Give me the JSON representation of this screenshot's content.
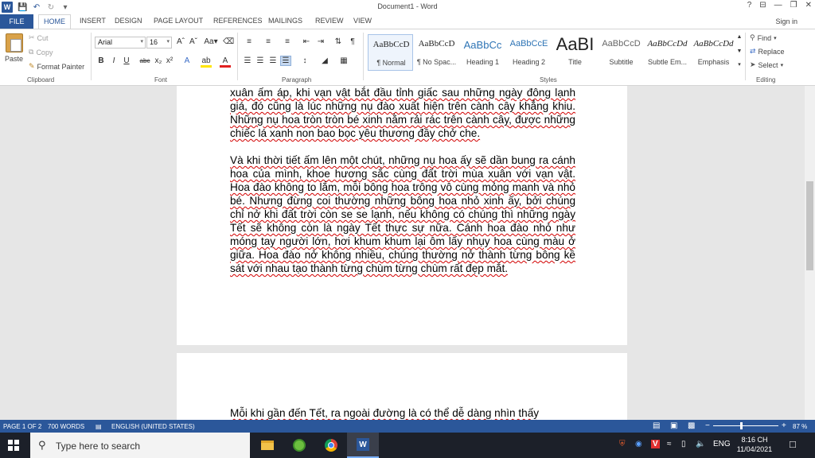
{
  "titlebar": {
    "doc_title": "Document1 - Word",
    "help": "?",
    "controls": [
      "⊟",
      "—",
      "❐",
      "✕"
    ]
  },
  "tabs": {
    "file": "FILE",
    "items": [
      "HOME",
      "INSERT",
      "DESIGN",
      "PAGE LAYOUT",
      "REFERENCES",
      "MAILINGS",
      "REVIEW",
      "VIEW"
    ],
    "signin": "Sign in"
  },
  "ribbon": {
    "clipboard": {
      "paste": "Paste",
      "cut": "Cut",
      "copy": "Copy",
      "format_painter": "Format Painter",
      "label": "Clipboard"
    },
    "font": {
      "name": "Arial",
      "size": "16",
      "label": "Font"
    },
    "paragraph": {
      "label": "Paragraph"
    },
    "styles": {
      "label": "Styles",
      "items": [
        {
          "sample": "AaBbCcD",
          "name": "¶ Normal"
        },
        {
          "sample": "AaBbCcD",
          "name": "¶ No Spac..."
        },
        {
          "sample": "AaBbCc",
          "name": "Heading 1"
        },
        {
          "sample": "AaBbCcE",
          "name": "Heading 2"
        },
        {
          "sample": "AaBI",
          "name": "Title"
        },
        {
          "sample": "AaBbCcD",
          "name": "Subtitle"
        },
        {
          "sample": "AaBbCcDd",
          "name": "Subtle Em..."
        },
        {
          "sample": "AaBbCcDd",
          "name": "Emphasis"
        }
      ]
    },
    "editing": {
      "find": "Find",
      "replace": "Replace",
      "select": "Select",
      "label": "Editing"
    }
  },
  "document": {
    "page1": {
      "p1": "xuân ấm áp, khi vạn vật bắt đầu tỉnh giấc sau những ngày đông lạnh giá, đó cũng là lúc những nụ đào xuất hiện trên cành cây khẳng khiu. Những nụ hoa tròn tròn bé xinh nằm rải rác trên cành cây, được những chiếc lá xanh non bao bọc yêu thương đầy chở che.",
      "p2": "Và khi thời tiết ấm lên một chút, những nụ hoa ấy sẽ dần bung ra cánh hoa của mình, khoe hương sắc cùng đất trời mùa xuân với vạn vật. Hoa đào không to lắm, mỗi bông hoa trông vô cùng mỏng manh và nhỏ bé. Nhưng đừng coi thường những bông hoa nhỏ xinh ấy, bởi chúng chỉ nở khi đất trời còn se se lạnh, nếu không có chúng thì những ngày Tết sẽ không còn là ngày Tết thực sự nữa. Cánh hoa đào nhỏ như móng tay người lớn, hơi khum khum lại ôm lấy nhụy hoa cùng màu ở giữa. Hoa đào nở không nhiều, chúng thường nở thành từng bông kề sát với nhau tạo thành từng chùm từng chùm rất đẹp mắt."
    },
    "page2": {
      "p1": "Mỗi khi gần đến Tết, ra ngoài đường là có thể dễ dàng nhìn thấy"
    }
  },
  "statusbar": {
    "page": "PAGE 1 OF 2",
    "words": "700 WORDS",
    "language": "ENGLISH (UNITED STATES)",
    "zoom": "87 %",
    "zoom_minus": "−",
    "zoom_plus": "+"
  },
  "taskbar": {
    "search_placeholder": "Type here to search",
    "lang": "ENG",
    "time": "8:16 CH",
    "date": "11/04/2021"
  },
  "colors": {
    "word_blue": "#2b579a",
    "taskbar": "#1c2029",
    "spellcheck": "#d20000"
  }
}
